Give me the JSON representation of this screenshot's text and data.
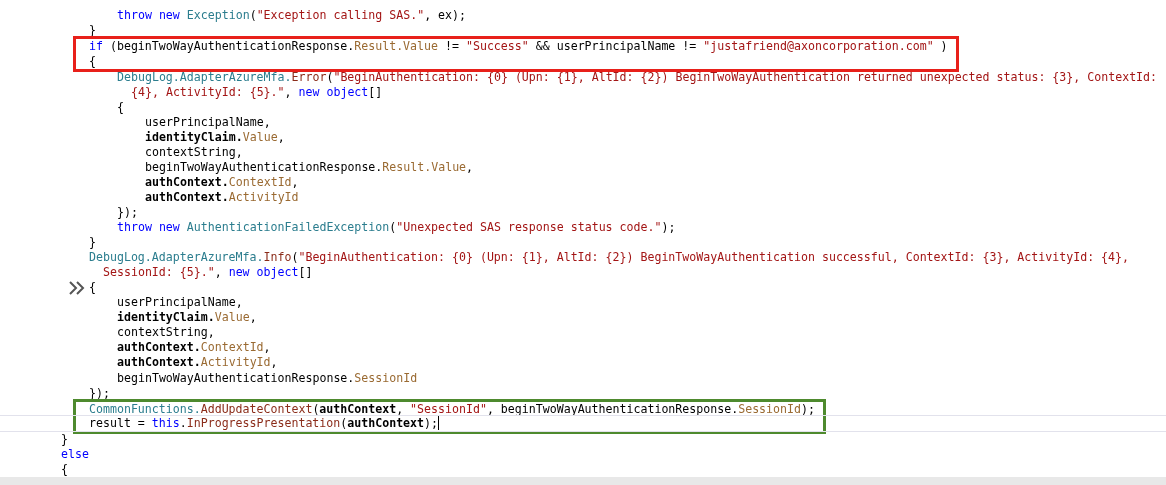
{
  "editor": {
    "items": [
      {
        "kind": "block",
        "children": [
          {
            "kind": "block",
            "children": [
              {
                "kind": "line",
                "tokens": [
                  {
                    "kind": "kw",
                    "t": "throw"
                  },
                  {
                    "kind": "kw",
                    "t": " new"
                  },
                  {
                    "kind": "ty",
                    "t": " Exception"
                  },
                  {
                    "kind": "p",
                    "t": "("
                  },
                  {
                    "kind": "st",
                    "t": "\"Exception calling SAS.\""
                  },
                  {
                    "kind": "p",
                    "t": ", ex);"
                  }
                ]
              }
            ]
          },
          {
            "kind": "line",
            "tokens": [
              {
                "kind": "p",
                "t": "}"
              }
            ]
          },
          {
            "kind": "frame",
            "color": "#e8201a",
            "children": [
              {
                "kind": "line",
                "tokens": [
                  {
                    "kind": "kw",
                    "t": "if"
                  },
                  {
                    "kind": "p",
                    "t": " (beginTwoWayAuthenticationResponse."
                  },
                  {
                    "kind": "pr",
                    "t": "Result.Value"
                  },
                  {
                    "kind": "p",
                    "t": " != "
                  },
                  {
                    "kind": "st",
                    "t": "\"Success\""
                  },
                  {
                    "kind": "p",
                    "t": " && userPrincipalName != "
                  },
                  {
                    "kind": "st",
                    "t": "\"justafriend@axoncorporation.com\""
                  },
                  {
                    "kind": "p",
                    "t": " )"
                  }
                ]
              },
              {
                "kind": "line",
                "tokens": [
                  {
                    "kind": "p",
                    "t": "{"
                  }
                ]
              }
            ]
          },
          {
            "kind": "block",
            "children": [
              {
                "kind": "line",
                "tokens": [
                  {
                    "kind": "ty",
                    "t": "DebugLog.AdapterAzureMfa."
                  },
                  {
                    "kind": "me",
                    "t": "Error"
                  },
                  {
                    "kind": "p",
                    "t": "("
                  },
                  {
                    "kind": "st",
                    "t": "\"BeginAuthentication: {0} (Upn: {1}, AltId: {2}) BeginTwoWayAuthentication returned unexpected status: {3}, ContextId:"
                  }
                ]
              },
              {
                "kind": "line",
                "wrapped": true,
                "tokens": [
                  {
                    "kind": "st",
                    "t": "{4}, ActivityId: {5}.\""
                  },
                  {
                    "kind": "p",
                    "t": ", "
                  },
                  {
                    "kind": "kw",
                    "t": "new object"
                  },
                  {
                    "kind": "p",
                    "t": "[]"
                  }
                ]
              },
              {
                "kind": "line",
                "tokens": [
                  {
                    "kind": "p",
                    "t": "{"
                  }
                ]
              },
              {
                "kind": "block",
                "children": [
                  {
                    "kind": "line",
                    "tokens": [
                      {
                        "kind": "p",
                        "t": "userPrincipalName,"
                      }
                    ]
                  },
                  {
                    "kind": "line",
                    "tokens": [
                      {
                        "kind": "b",
                        "t": "identityClaim."
                      },
                      {
                        "kind": "pr",
                        "t": "Value"
                      },
                      {
                        "kind": "p",
                        "t": ","
                      }
                    ]
                  },
                  {
                    "kind": "line",
                    "tokens": [
                      {
                        "kind": "p",
                        "t": "contextString,"
                      }
                    ]
                  },
                  {
                    "kind": "line",
                    "tokens": [
                      {
                        "kind": "p",
                        "t": "beginTwoWayAuthenticationResponse."
                      },
                      {
                        "kind": "pr",
                        "t": "Result.Value"
                      },
                      {
                        "kind": "p",
                        "t": ","
                      }
                    ]
                  },
                  {
                    "kind": "line",
                    "tokens": [
                      {
                        "kind": "b",
                        "t": "authContext."
                      },
                      {
                        "kind": "pr",
                        "t": "ContextId"
                      },
                      {
                        "kind": "p",
                        "t": ","
                      }
                    ]
                  },
                  {
                    "kind": "line",
                    "tokens": [
                      {
                        "kind": "b",
                        "t": "authContext."
                      },
                      {
                        "kind": "pr",
                        "t": "ActivityId"
                      }
                    ]
                  }
                ]
              },
              {
                "kind": "line",
                "tokens": [
                  {
                    "kind": "p",
                    "t": "});"
                  }
                ]
              },
              {
                "kind": "line",
                "tokens": [
                  {
                    "kind": "kw",
                    "t": "throw new"
                  },
                  {
                    "kind": "ty",
                    "t": " AuthenticationFailedException"
                  },
                  {
                    "kind": "p",
                    "t": "("
                  },
                  {
                    "kind": "st",
                    "t": "\"Unexpected SAS response status code.\""
                  },
                  {
                    "kind": "p",
                    "t": ");"
                  }
                ]
              }
            ]
          },
          {
            "kind": "line",
            "tokens": [
              {
                "kind": "p",
                "t": "}"
              }
            ]
          },
          {
            "kind": "line",
            "tokens": [
              {
                "kind": "ty",
                "t": "DebugLog.AdapterAzureMfa."
              },
              {
                "kind": "me",
                "t": "Info"
              },
              {
                "kind": "p",
                "t": "("
              },
              {
                "kind": "st",
                "t": "\"BeginAuthentication: {0} (Upn: {1}, AltId: {2}) BeginTwoWayAuthentication successful, ContextId: {3}, ActivityId: {4},"
              }
            ]
          },
          {
            "kind": "line",
            "wrapped": true,
            "tokens": [
              {
                "kind": "st",
                "t": "SessionId: {5}.\""
              },
              {
                "kind": "p",
                "t": ", "
              },
              {
                "kind": "kw",
                "t": "new object"
              },
              {
                "kind": "p",
                "t": "[]"
              }
            ]
          },
          {
            "kind": "line",
            "margin_glyph": true,
            "tokens": [
              {
                "kind": "p",
                "t": "{"
              }
            ]
          },
          {
            "kind": "block",
            "children": [
              {
                "kind": "line",
                "tokens": [
                  {
                    "kind": "p",
                    "t": "userPrincipalName,"
                  }
                ]
              },
              {
                "kind": "line",
                "tokens": [
                  {
                    "kind": "b",
                    "t": "identityClaim."
                  },
                  {
                    "kind": "pr",
                    "t": "Value"
                  },
                  {
                    "kind": "p",
                    "t": ","
                  }
                ]
              },
              {
                "kind": "line",
                "tokens": [
                  {
                    "kind": "p",
                    "t": "contextString,"
                  }
                ]
              },
              {
                "kind": "line",
                "tokens": [
                  {
                    "kind": "b",
                    "t": "authContext."
                  },
                  {
                    "kind": "pr",
                    "t": "ContextId"
                  },
                  {
                    "kind": "p",
                    "t": ","
                  }
                ]
              },
              {
                "kind": "line",
                "tokens": [
                  {
                    "kind": "b",
                    "t": "authContext."
                  },
                  {
                    "kind": "pr",
                    "t": "ActivityId"
                  },
                  {
                    "kind": "p",
                    "t": ","
                  }
                ]
              },
              {
                "kind": "line",
                "tokens": [
                  {
                    "kind": "p",
                    "t": "beginTwoWayAuthenticationResponse."
                  },
                  {
                    "kind": "pr",
                    "t": "SessionId"
                  }
                ]
              }
            ]
          },
          {
            "kind": "line",
            "tokens": [
              {
                "kind": "p",
                "t": "});"
              }
            ]
          },
          {
            "kind": "frame",
            "color": "#4e8a2e",
            "children": [
              {
                "kind": "line",
                "tokens": [
                  {
                    "kind": "ty",
                    "t": "CommonFunctions."
                  },
                  {
                    "kind": "me",
                    "t": "AddUpdateContext"
                  },
                  {
                    "kind": "p",
                    "t": "("
                  },
                  {
                    "kind": "b",
                    "t": "authContext"
                  },
                  {
                    "kind": "p",
                    "t": ", "
                  },
                  {
                    "kind": "st",
                    "t": "\"SessionId\""
                  },
                  {
                    "kind": "p",
                    "t": ", beginTwoWayAuthenticationResponse."
                  },
                  {
                    "kind": "pr",
                    "t": "SessionId"
                  },
                  {
                    "kind": "p",
                    "t": ");"
                  }
                ]
              },
              {
                "kind": "line",
                "current": true,
                "tokens": [
                  {
                    "kind": "p",
                    "t": "result = "
                  },
                  {
                    "kind": "kw",
                    "t": "this"
                  },
                  {
                    "kind": "p",
                    "t": "."
                  },
                  {
                    "kind": "me",
                    "t": "InProgressPresentation"
                  },
                  {
                    "kind": "p",
                    "t": "("
                  },
                  {
                    "kind": "b",
                    "t": "authContext"
                  },
                  {
                    "kind": "p",
                    "t": ");"
                  }
                ]
              }
            ]
          }
        ]
      },
      {
        "kind": "line",
        "tokens": [
          {
            "kind": "p",
            "t": "}"
          }
        ]
      },
      {
        "kind": "line",
        "tokens": [
          {
            "kind": "kw",
            "t": "else"
          }
        ]
      },
      {
        "kind": "line",
        "tokens": [
          {
            "kind": "p",
            "t": "{"
          }
        ]
      }
    ]
  }
}
